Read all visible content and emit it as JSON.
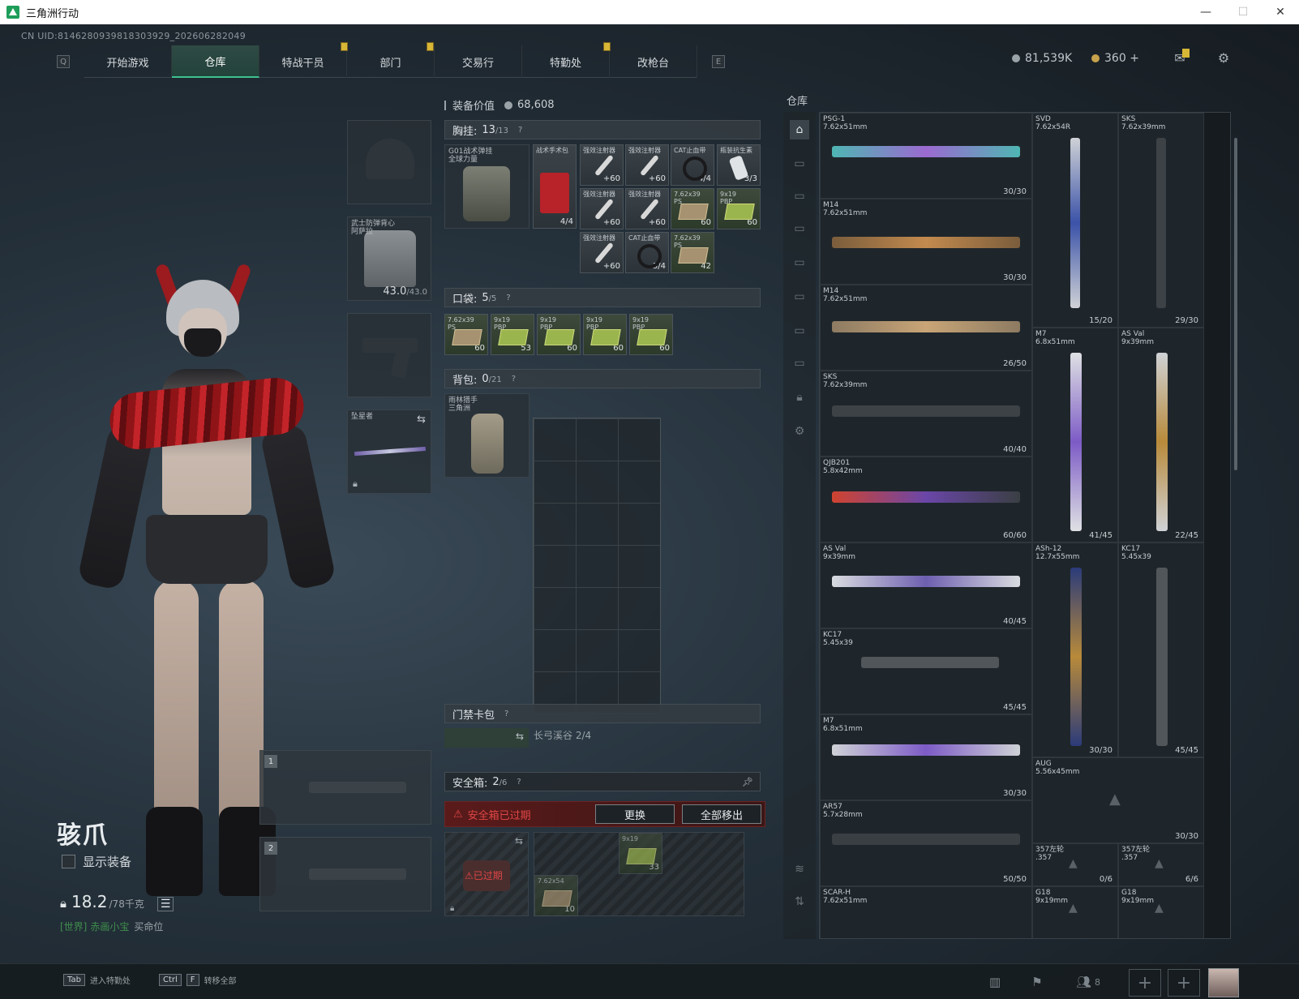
{
  "window": {
    "title": "三角洲行动",
    "min": "—",
    "max": "☐",
    "close": "✕"
  },
  "uid": "CN UID:8146280939818303929_202606282049",
  "nav": {
    "left_key": "Q",
    "right_key": "E",
    "tabs": [
      "开始游戏",
      "仓库",
      "特战干员",
      "部门",
      "交易行",
      "特勤处",
      "改枪台"
    ],
    "active_tab": "仓库"
  },
  "currency": {
    "silver": "81,539K",
    "gold": "360",
    "gold_plus": "+"
  },
  "character": {
    "name": "骇爪",
    "show_equipment": "显示装备",
    "weight": "18.2",
    "weight_max": "/78千克",
    "chat_channel": "[世界]",
    "chat_user": "赤画小宝",
    "chat_msg": "买命位"
  },
  "gear_slots": {
    "armor_label": "武士防弹背心\n阿萨拉",
    "armor_dur": "43.0",
    "armor_max": "/43.0",
    "melee_label": "坠星者",
    "weapon1_num": "1",
    "weapon2_num": "2"
  },
  "center": {
    "value_label": "装备价值",
    "value": "68,608",
    "rig": {
      "title": "胸挂:",
      "count": "13",
      "max": "/13",
      "q": "?"
    },
    "rig_item": "G01战术弹挂\n全球力量",
    "rig_cells": [
      {
        "label": "战术手术包",
        "qty": "4/4"
      },
      {
        "label": "强效注射器",
        "qty": "+60"
      },
      {
        "label": "强效注射器",
        "qty": "+60"
      },
      {
        "label": "CAT止血带",
        "qty": "4/4"
      },
      {
        "label": "瓶装抗生素",
        "qty": "3/3"
      },
      {
        "label": "强效注射器",
        "qty": "+60"
      },
      {
        "label": "强效注射器",
        "qty": "+60"
      },
      {
        "label": "7.62x39\nPS",
        "qty": "60"
      },
      {
        "label": "9x19\nPBP",
        "qty": "60"
      },
      {
        "label": "强效注射器",
        "qty": "+60"
      },
      {
        "label": "CAT止血带",
        "qty": "3/4"
      },
      {
        "label": "7.62x39\nPS",
        "qty": "42"
      }
    ],
    "pocket": {
      "title": "口袋:",
      "count": "5",
      "max": "/5",
      "q": "?"
    },
    "pocket_cells": [
      {
        "label": "7.62x39\nPS",
        "qty": "60"
      },
      {
        "label": "9x19\nPBP",
        "qty": "53"
      },
      {
        "label": "9x19\nPBP",
        "qty": "60"
      },
      {
        "label": "9x19\nPBP",
        "qty": "60"
      },
      {
        "label": "9x19\nPBP",
        "qty": "60"
      }
    ],
    "backpack": {
      "title": "背包:",
      "count": "0",
      "max": "/21",
      "q": "?"
    },
    "backpack_item": "雨林猎手\n三角洲",
    "keycard": {
      "title": "门禁卡包",
      "q": "?",
      "item": "长弓溪谷 2/4"
    },
    "safe": {
      "title": "安全箱:",
      "count": "2",
      "max": "/6",
      "q": "?"
    },
    "expired_warning": "安全箱已过期",
    "replace_btn": "更换",
    "move_all_btn": "全部移出",
    "expired_tag": "已过期",
    "safe_cells": [
      {
        "label": "9x19",
        "qty": "33"
      },
      {
        "label": "7.62x54",
        "qty": "10"
      }
    ]
  },
  "warehouse": {
    "title": "仓库",
    "items": [
      {
        "name": "PSG-1\n7.62x51mm",
        "dur": "30/30"
      },
      {
        "name": "SVD\n7.62x54R",
        "dur": "15/20"
      },
      {
        "name": "SKS\n7.62x39mm",
        "dur": "29/30"
      },
      {
        "name": "M14\n7.62x51mm",
        "dur": "30/30"
      },
      {
        "name": "M14\n7.62x51mm",
        "dur": "26/50"
      },
      {
        "name": "M7\n6.8x51mm",
        "dur": "41/45"
      },
      {
        "name": "AS Val\n9x39mm",
        "dur": "22/45"
      },
      {
        "name": "SKS\n7.62x39mm",
        "dur": "40/40"
      },
      {
        "name": "QJB201\n5.8x42mm",
        "dur": "60/60"
      },
      {
        "name": "AS Val\n9x39mm",
        "dur": "40/45"
      },
      {
        "name": "ASh-12\n12.7x55mm",
        "dur": "30/30"
      },
      {
        "name": "KC17\n5.45x39",
        "dur": "45/45"
      },
      {
        "name": "KC17\n5.45x39",
        "dur": "45/45"
      },
      {
        "name": "M7\n6.8x51mm",
        "dur": "30/30"
      },
      {
        "name": "AUG\n5.56x45mm",
        "dur": "30/30"
      },
      {
        "name": "AR57\n5.7x28mm",
        "dur": "50/50"
      },
      {
        "name": "357左轮\n.357",
        "dur": "0/6"
      },
      {
        "name": "357左轮\n.357",
        "dur": "6/6"
      },
      {
        "name": "SCAR-H\n7.62x51mm",
        "dur": ""
      },
      {
        "name": "G18\n9x19mm",
        "dur": ""
      },
      {
        "name": "G18\n9x19mm",
        "dur": ""
      }
    ]
  },
  "bottom": {
    "hint1_key": "Tab",
    "hint1": "进入特勤处",
    "hint2_key1": "Ctrl",
    "hint2_key2": "F",
    "hint2": "转移全部",
    "squad_count": "8"
  },
  "colors": {
    "accent": "#3ec28f",
    "warning": "#e04545",
    "badge": "#d8b636"
  }
}
